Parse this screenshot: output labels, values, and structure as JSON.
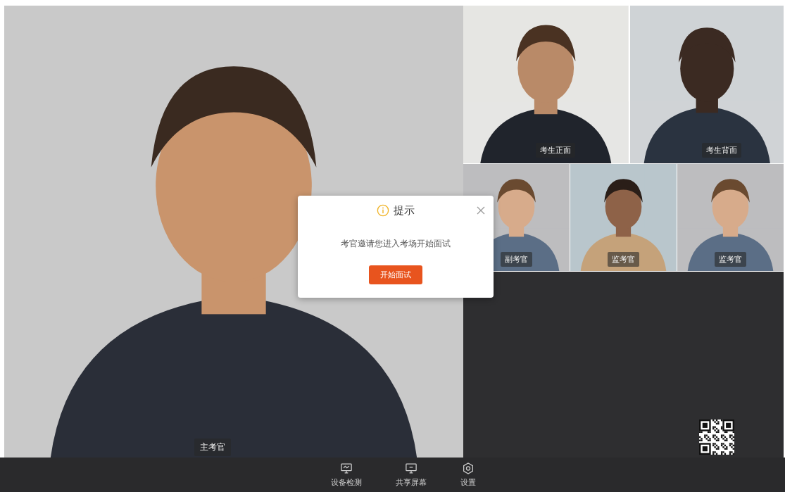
{
  "main_video": {
    "label": "主考官"
  },
  "tiles": [
    {
      "label": "考生正面"
    },
    {
      "label": "考生背面"
    },
    {
      "label": "副考官"
    },
    {
      "label": "监考官"
    },
    {
      "label": "监考官"
    }
  ],
  "dialog": {
    "title": "提示",
    "message": "考官邀请您进入考场开始面试",
    "button": "开始面试"
  },
  "toolbar": [
    {
      "kind": "device-check",
      "label": "设备检测"
    },
    {
      "kind": "share-screen",
      "label": "共享屏幕"
    },
    {
      "kind": "settings",
      "label": "设置"
    }
  ]
}
